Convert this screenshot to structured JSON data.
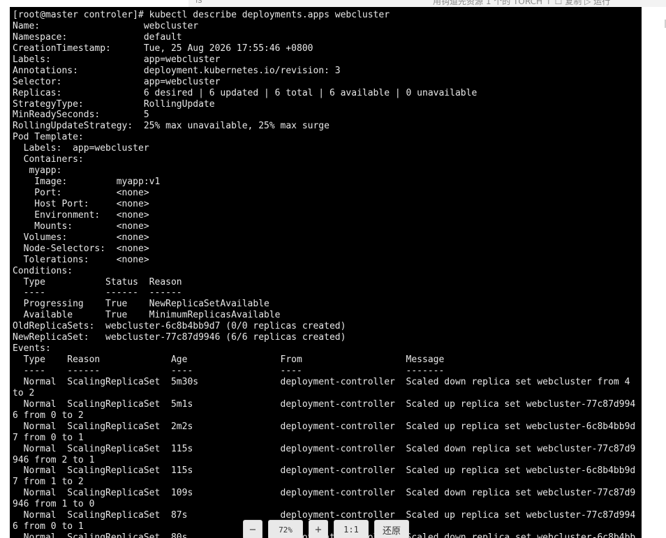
{
  "background": {
    "left_text": "ls",
    "right_text": "用钩道先资源 1 个的 TORCH  ↑  ☐  复制  ▷ 运行"
  },
  "terminal": {
    "lines": [
      "[root@master controler]# kubectl describe deployments.apps webcluster",
      "Name:                   webcluster",
      "Namespace:              default",
      "CreationTimestamp:      Tue, 25 Aug 2026 17:55:46 +0800",
      "Labels:                 app=webcluster",
      "Annotations:            deployment.kubernetes.io/revision: 3",
      "Selector:               app=webcluster",
      "Replicas:               6 desired | 6 updated | 6 total | 6 available | 0 unavailable",
      "StrategyType:           RollingUpdate",
      "MinReadySeconds:        5",
      "RollingUpdateStrategy:  25% max unavailable, 25% max surge",
      "Pod Template:",
      "  Labels:  app=webcluster",
      "  Containers:",
      "   myapp:",
      "    Image:         myapp:v1",
      "    Port:          <none>",
      "    Host Port:     <none>",
      "    Environment:   <none>",
      "    Mounts:        <none>",
      "  Volumes:         <none>",
      "  Node-Selectors:  <none>",
      "  Tolerations:     <none>",
      "Conditions:",
      "  Type           Status  Reason",
      "  ----           ------  ------",
      "  Progressing    True    NewReplicaSetAvailable",
      "  Available      True    MinimumReplicasAvailable",
      "OldReplicaSets:  webcluster-6c8b4bb9d7 (0/0 replicas created)",
      "NewReplicaSet:   webcluster-77c87d9946 (6/6 replicas created)",
      "Events:",
      "  Type    Reason             Age                 From                   Message",
      "  ----    ------             ----                ----                   -------",
      "  Normal  ScalingReplicaSet  5m30s               deployment-controller  Scaled down replica set webcluster from 4",
      "to 2",
      "  Normal  ScalingReplicaSet  5m1s                deployment-controller  Scaled up replica set webcluster-77c87d994",
      "6 from 0 to 2",
      "  Normal  ScalingReplicaSet  2m2s                deployment-controller  Scaled up replica set webcluster-6c8b4bb9d",
      "7 from 0 to 1",
      "  Normal  ScalingReplicaSet  115s                deployment-controller  Scaled down replica set webcluster-77c87d9",
      "946 from 2 to 1",
      "  Normal  ScalingReplicaSet  115s                deployment-controller  Scaled up replica set webcluster-6c8b4bb9d",
      "7 from 1 to 2",
      "  Normal  ScalingReplicaSet  109s                deployment-controller  Scaled down replica set webcluster-77c87d9",
      "946 from 1 to 0",
      "  Normal  ScalingReplicaSet  87s                 deployment-controller  Scaled up replica set webcluster-77c87d994",
      "6 from 0 to 1",
      "  Normal  ScalingReplicaSet  80s                 deployment-controller  Scaled down replica set webcluster-6c8b4bb"
    ]
  },
  "zoom_bar": {
    "minus_label": "−",
    "level": "72%",
    "plus_label": "+",
    "ratio_label": "1:1",
    "reset_label": "还原"
  },
  "colors": {
    "terminal_bg": "#000000",
    "terminal_fg": "#e8e8e8",
    "toolbar_button": "#e9e9e9"
  }
}
